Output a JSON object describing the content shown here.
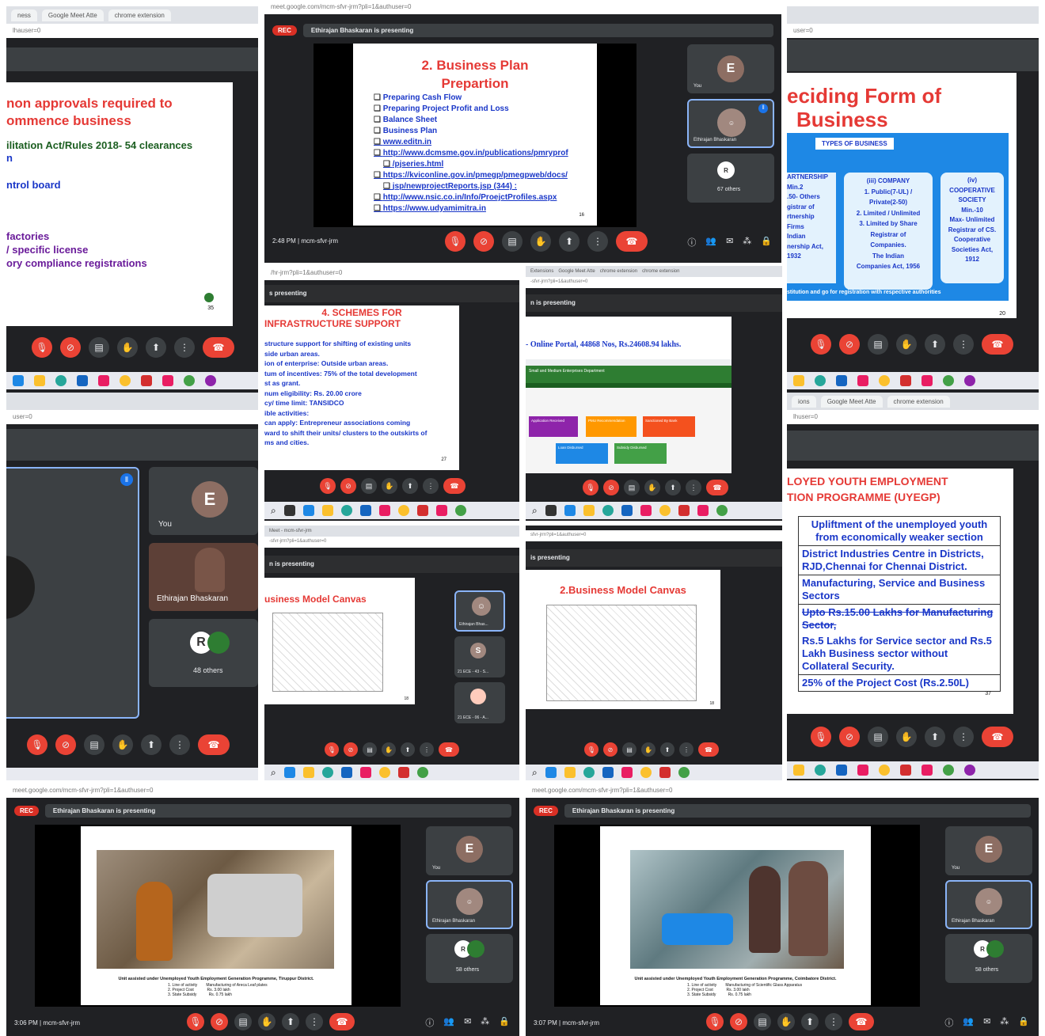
{
  "tile_a": {
    "tabs": [
      "ness",
      "Google Meet Atte",
      "chrome extension"
    ],
    "url": "lhauser=0",
    "slide_title_lines": [
      "non approvals required to",
      "ommence business"
    ],
    "slide_line1": "ilitation Act/Rules 2018- 54 clearances",
    "slide_line2": "n",
    "slide_line3": "ntrol board",
    "slide_line4": "factories",
    "slide_line5": "/ specific license",
    "slide_line6": "ory compliance registrations",
    "page_no": "35"
  },
  "tile_b": {
    "url": "meet.google.com/mcm-sfvr-jrm?pli=1&authuser=0",
    "rec": "REC",
    "presenter": "Ethirajan Bhaskaran is presenting",
    "slide_title": "2. Business Plan",
    "slide_title2": "Prepartion",
    "bullets": [
      "Preparing Cash Flow",
      "Preparing Project Profit and Loss",
      "Balance Sheet",
      "Business Plan",
      "www.editn.in",
      "http://www.dcmsme.gov.in/publications/pmryprof",
      "/pjseries.html",
      "https://kviconline.gov.in/pmegp/pmegpweb/docs/",
      "jsp/newprojectReports.jsp (344) :",
      "http://www.nsic.co.in/Info/ProejctProfiles.aspx",
      "https://www.udyamimitra.in"
    ],
    "page_no": "16",
    "you_initial": "E",
    "you_label": "You",
    "presenter_name": "Ethirajan Bhaskaran",
    "others": "67 others",
    "time": "2:48 PM",
    "meeting_code": "mcm-sfvr-jrm"
  },
  "tile_c": {
    "url": "user=0",
    "title_line1": "eciding Form of",
    "title_line2": "Business",
    "types": "TYPES OF BUSINESS",
    "col1": [
      "ARTNERSHIP",
      "Min.2",
      ".50- Others",
      "gistrar of",
      "rtnership",
      "Firms",
      "Indian",
      "nership Act,",
      "1932"
    ],
    "col2": [
      "(iii) COMPANY",
      "1. Public(7-UL) /",
      "Private(2-50)",
      "2. Limited / Unlimited",
      "3. Limited by Share",
      "Registrar of",
      "Companies.",
      "The Indian",
      "Companies Act, 1956"
    ],
    "col3": [
      "(iv)",
      "COOPERATIVE",
      "SOCIETY",
      "Min.-10",
      "Max- Unlimited",
      "Registrar of CS.",
      "Cooperative",
      "Societies Act,",
      "1912"
    ],
    "footer": "stitution and go for registration with respective authorities",
    "page_no": "20"
  },
  "tile_d": {
    "url": "/hr-jrm?pli=1&authuser=0",
    "presenting": "s presenting",
    "title1": "4. SCHEMES FOR",
    "title2": "INFRASTRUCTURE SUPPORT",
    "lines": [
      "structure support for shifting of existing units",
      "side urban areas.",
      "ion of enterprise:   Outside urban areas.",
      "tum of incentives: 75% of the total development",
      "st as grant.",
      "num eligibility: Rs. 20.00 crore",
      "cy/ time limit: TANSIDCO",
      "ible activities:",
      "can apply: Entrepreneur associations coming",
      "ward to shift their units/ clusters to the outskirts of",
      "ms and cities."
    ],
    "page_no": "27"
  },
  "tile_e": {
    "tabs": [
      "Extensions",
      "Google Meet Atte",
      "chrome extension",
      "chrome extension"
    ],
    "url": "-sfvr-jrm?pli=1&authuser=0",
    "presenting": "n is presenting",
    "headline": "- Online Portal, 44868 Nos, Rs.24608.94 lakhs.",
    "site_title": "Small and Medium Enterprises Department",
    "boxes": [
      "Application Received",
      "PMU Recommendation",
      "Sanctioned By Bank",
      "Loan Disbursed",
      "Subsidy Disbursed"
    ]
  },
  "tile_f": {
    "tabs": [
      "ions",
      "Google Meet Atte",
      "chrome extension"
    ],
    "url": "lhuser=0",
    "title1": "LOYED YOUTH EMPLOYMENT",
    "title2": "TION PROGRAMME (UYEGP)",
    "rows": [
      "Upliftment of the unemployed  youth from economically weaker section",
      "District Industries Centre in Districts, RJD,Chennai for Chennai District.",
      "Manufacturing, Service and Business Sectors",
      "Upto Rs.15.00 Lakhs for Manufacturing Sector,",
      "Rs.5 Lakhs for Service  sector and Rs.5 Lakh Business sector without Collateral Security.",
      "25% of the Project Cost (Rs.2.50L)"
    ],
    "page_no": "37"
  },
  "tile_g": {
    "url": "user=0",
    "you_initial": "E",
    "you_label": "You",
    "presenter_name": "Ethirajan Bhaskaran",
    "others": "48 others"
  },
  "tile_h": {
    "tabs": [
      "Meet - mcm-sfvr-jrm"
    ],
    "url": "-sfvr-jrm?pli=1&authuser=0",
    "presenting": "n is presenting",
    "slide_title": "usiness Model Canvas",
    "page_no": "18",
    "p1": "Ethirajan Bhas...",
    "p2_initial": "S",
    "p2": "21 ECE - 43 - S...",
    "p3": "21 ECE - 06 - A..."
  },
  "tile_i": {
    "url": "sfvr-jrm?pli=1&authuser=0",
    "presenting": "is presenting",
    "slide_title": "2.Business Model Canvas",
    "page_no": "18"
  },
  "tile_j": {
    "url": "meet.google.com/mcm-sfvr-jrm?pli=1&authuser=0",
    "rec": "REC",
    "presenter": "Ethirajan Bhaskaran is presenting",
    "caption": "Unit assisted under Unemployed Youth Employment Generation Programme, Tiruppur District.",
    "caption_lines": [
      "1. Line of activity        Manufacturing of Areca Leaf plates",
      "2. Project Cost            Rs. 3.00 lakh",
      "3. State Subsidy           Rs. 0.75 lakh"
    ],
    "you_initial": "E",
    "you_label": "You",
    "presenter_name": "Ethirajan Bhaskaran",
    "others": "58 others",
    "time": "3:06 PM",
    "meeting_code": "mcm-sfvr-jrm"
  },
  "tile_k": {
    "url": "meet.google.com/mcm-sfvr-jrm?pli=1&authuser=0",
    "rec": "REC",
    "presenter": "Ethirajan Bhaskaran is presenting",
    "caption": "Unit assisted under Unemployed Youth Employment Generation Programme, Coimbatore District.",
    "caption_lines": [
      "1. Line of activity        Manufacturing of Scientific Glass Apparatus",
      "2. Project Cost            Rs. 3.00 lakh",
      "3. State Subsidy           Rs. 0.75 lakh"
    ],
    "you_initial": "E",
    "you_label": "You",
    "presenter_name": "Ethirajan Bhaskaran",
    "others": "58 others",
    "time": "3:07 PM",
    "meeting_code": "mcm-sfvr-jrm"
  },
  "colors": {
    "accent_red": "#ea4335",
    "meet_bg": "#202124",
    "link_blue": "#1a37c8",
    "title_red": "#e53935"
  }
}
